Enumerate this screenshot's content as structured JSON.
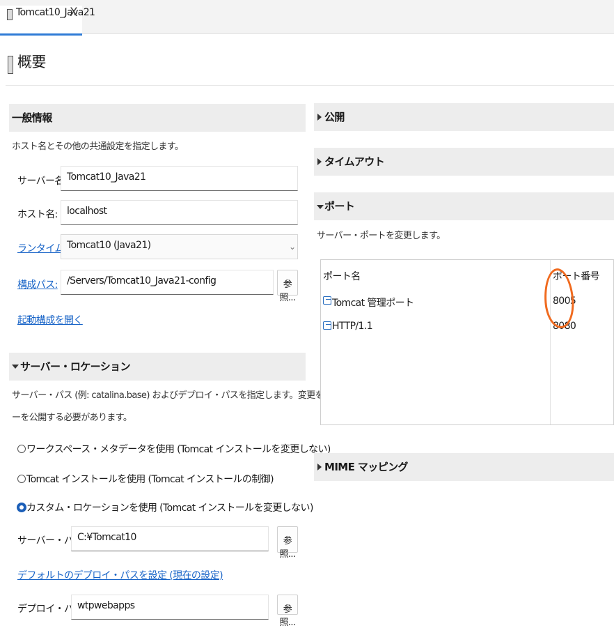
{
  "tab": {
    "label": "Tomcat10_Java21",
    "close": "X"
  },
  "page_title": "概要",
  "general": {
    "title": "一般情報",
    "description": "ホスト名とその他の共通設定を指定します。",
    "server_name_label": "サーバー名:",
    "server_name_value": "Tomcat10_Java21",
    "host_name_label": "ホスト名:",
    "host_name_value": "localhost",
    "runtime_label": "ランタイム環境:",
    "runtime_value": "Tomcat10 (Java21)",
    "config_path_label": "構成パス:",
    "config_path_value": "/Servers/Tomcat10_Java21-config",
    "browse_label": "参照...",
    "open_launch_config": "起動構成を開く"
  },
  "server_locations": {
    "title": "サーバー・ロケーション",
    "description_line1": "サーバー・パス (例: catalina.base) およびデプロイ・パスを指定します。変更を有効にするにはモジュールなしでサーバ",
    "description_line2": "ーを公開する必要があります。",
    "options": [
      {
        "label": "ワークスペース・メタデータを使用 (Tomcat インストールを変更しない)",
        "selected": false
      },
      {
        "label": "Tomcat インストールを使用 (Tomcat インストールの制御)",
        "selected": false
      },
      {
        "label": "カスタム・ロケーションを使用 (Tomcat インストールを変更しない)",
        "selected": true
      }
    ],
    "server_path_label": "サーバー・パス:",
    "server_path_value": "C:¥Tomcat10",
    "browse_label": "参照...",
    "default_deploy_link": "デフォルトのデプロイ・パスを設定 (現在の設定)",
    "deploy_path_label": "デプロイ・パス:",
    "deploy_path_value": "wtpwebapps",
    "browse_label2": "参照..."
  },
  "publish": {
    "title": "公開"
  },
  "timeout": {
    "title": "タイムアウト"
  },
  "ports": {
    "title": "ポート",
    "description": "サーバー・ポートを変更します。",
    "columns": [
      "ポート名",
      "ポート番号"
    ],
    "rows": [
      {
        "name": "Tomcat 管理ポート",
        "number": "8005"
      },
      {
        "name": "HTTP/1.1",
        "number": "8080"
      }
    ],
    "highlight_color": "#f06a1e"
  },
  "mime": {
    "title": "MIME マッピング"
  }
}
